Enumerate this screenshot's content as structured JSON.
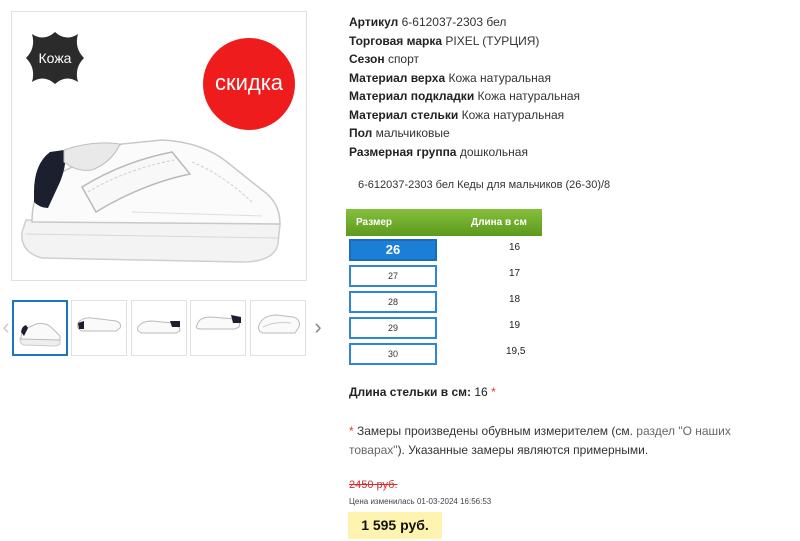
{
  "gallery": {
    "main_image": "white-kids-sneaker-photo",
    "leather_badge": "Кожа",
    "sale_badge": "скидка",
    "thumbnails": [
      "sneaker-side-view",
      "sneaker-top-view",
      "sneaker-pair-view",
      "sneaker-back-view",
      "sneaker-sole-view"
    ],
    "prev_icon": "chevron-left-icon",
    "next_icon": "chevron-right-icon"
  },
  "specs": [
    {
      "label": "Артикул",
      "value": "6-612037-2303 бел"
    },
    {
      "label": "Торговая марка",
      "value": "PIXEL (ТУРЦИЯ)"
    },
    {
      "label": "Сезон",
      "value": "спорт"
    },
    {
      "label": "Материал верха",
      "value": "Кожа натуральная"
    },
    {
      "label": "Материал подкладки",
      "value": "Кожа натуральная"
    },
    {
      "label": "Материал стельки",
      "value": "Кожа натуральная"
    },
    {
      "label": "Пол",
      "value": "мальчиковые"
    },
    {
      "label": "Размерная группа",
      "value": "дошкольная"
    }
  ],
  "model_line": "6-612037-2303 бел Кеды для мальчиков (26-30)/8",
  "size_table": {
    "header_size": "Размер",
    "header_length": "Длина в см",
    "rows": [
      {
        "size": "26",
        "length": "16"
      },
      {
        "size": "27",
        "length": "17"
      },
      {
        "size": "28",
        "length": "18"
      },
      {
        "size": "29",
        "length": "19"
      },
      {
        "size": "30",
        "length": "19,5"
      }
    ],
    "selected_size": "26"
  },
  "insole": {
    "label": "Длина стельки в см:",
    "value": "16",
    "star": "*"
  },
  "note": {
    "star": "*",
    "text_before": " Замеры произведены обувным измерителем (см. ",
    "link": "раздел \"О наших товарах\"",
    "text_after": "). Указанные замеры являются примерными."
  },
  "price": {
    "old": "2450 руб.",
    "changed": "Цена изменилась 01-03-2024 16:56:53",
    "current": "1 595 руб."
  },
  "colors": {
    "sale_red": "#ee1c1c",
    "table_header_green": "#6aa82a",
    "size_blue": "#1b7fd8",
    "price_highlight": "#fff3b0"
  }
}
